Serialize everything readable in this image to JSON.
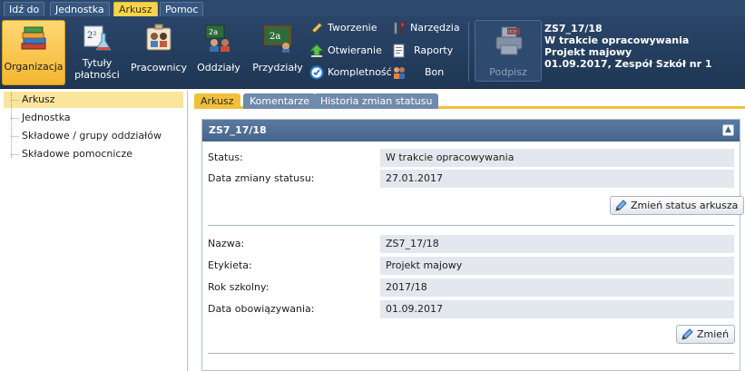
{
  "menu": {
    "tabs": [
      {
        "label": "Idź do"
      },
      {
        "label": "Jednostka"
      },
      {
        "label": "Arkusz",
        "active": true
      },
      {
        "label": "Pomoc"
      }
    ]
  },
  "ribbon": {
    "big_buttons": [
      {
        "label": "Organizacja",
        "icon": "books-icon",
        "active": true
      },
      {
        "label": "Tytuły płatności",
        "icon": "formula-flask-icon"
      },
      {
        "label": "Pracownicy",
        "icon": "staff-board-icon"
      },
      {
        "label": "Oddziały",
        "icon": "students-icon"
      },
      {
        "label": "Przydziały",
        "icon": "chalkboard-icon"
      }
    ],
    "small_buttons": [
      {
        "label": "Tworzenie",
        "icon": "pencil-icon"
      },
      {
        "label": "Otwieranie",
        "icon": "green-arrow-up-icon"
      },
      {
        "label": "Kompletność",
        "icon": "check-circle-icon"
      },
      {
        "label": "Narzędzia",
        "icon": "tools-icon"
      },
      {
        "label": "Raporty",
        "icon": "report-icon"
      },
      {
        "label": "Bon",
        "icon": "people-icon"
      }
    ],
    "sign": {
      "label": "Podpisz",
      "icon": "pdf-printer-icon",
      "enabled": false
    },
    "doc_info": {
      "line1": "ZS7_17/18",
      "line2": "W trakcie opracowywania",
      "line3": "Projekt majowy",
      "line4": "01.09.2017, Zespół Szkół nr 1"
    }
  },
  "tree": {
    "items": [
      {
        "label": "Arkusz",
        "selected": true
      },
      {
        "label": "Jednostka"
      },
      {
        "label": "Składowe / grupy oddziałów"
      },
      {
        "label": "Składowe pomocnicze"
      }
    ]
  },
  "content_tabs": [
    {
      "label": "Arkusz",
      "active": true
    },
    {
      "label": "Komentarze"
    },
    {
      "label": "Historia zmian statusu"
    }
  ],
  "panel": {
    "title": "ZS7_17/18",
    "status_section": {
      "rows": [
        {
          "label": "Status:",
          "value": "W trakcie opracowywania"
        },
        {
          "label": "Data zmiany statusu:",
          "value": "27.01.2017"
        }
      ],
      "button_label": "Zmień status arkusza"
    },
    "details_section": {
      "rows": [
        {
          "label": "Nazwa:",
          "value": "ZS7_17/18"
        },
        {
          "label": "Etykieta:",
          "value": "Projekt majowy"
        },
        {
          "label": "Rok szkolny:",
          "value": "2017/18"
        },
        {
          "label": "Data obowiązywania:",
          "value": "01.09.2017"
        }
      ],
      "button_label": "Zmień"
    }
  },
  "colors": {
    "menubar": "#2c4a6e",
    "ribbon": "#24405f",
    "accent_yellow": "#f2bf3a",
    "panel_header": "#4f6f96",
    "field_bg": "#e3e8ee"
  }
}
